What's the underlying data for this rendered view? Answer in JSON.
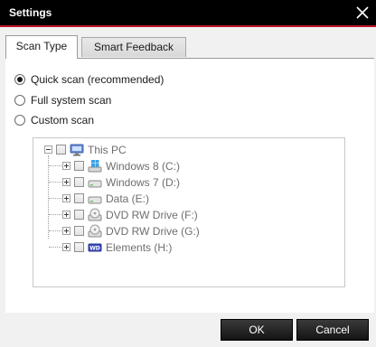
{
  "window": {
    "title": "Settings"
  },
  "colors": {
    "titlebar": "#000000",
    "accent": "#c0152a",
    "button": "#1e1e1e",
    "panel": "#ffffff",
    "background": "#f1f1f1"
  },
  "tabs": [
    {
      "label": "Scan Type",
      "active": true
    },
    {
      "label": "Smart Feedback",
      "active": false
    }
  ],
  "scan_options": [
    {
      "label": "Quick scan (recommended)",
      "checked": true
    },
    {
      "label": "Full system scan",
      "checked": false
    },
    {
      "label": "Custom scan",
      "checked": false
    }
  ],
  "tree": {
    "root": {
      "label": "This PC",
      "icon": "computer-icon"
    },
    "drives": [
      {
        "label": "Windows 8 (C:)",
        "icon": "windows-drive-icon"
      },
      {
        "label": "Windows 7 (D:)",
        "icon": "hard-drive-icon"
      },
      {
        "label": "Data (E:)",
        "icon": "hard-drive-icon"
      },
      {
        "label": "DVD RW Drive (F:)",
        "icon": "dvd-drive-icon"
      },
      {
        "label": "DVD RW Drive (G:)",
        "icon": "dvd-drive-icon"
      },
      {
        "label": "Elements (H:)",
        "icon": "wd-drive-icon"
      }
    ]
  },
  "buttons": {
    "ok": "OK",
    "cancel": "Cancel"
  }
}
